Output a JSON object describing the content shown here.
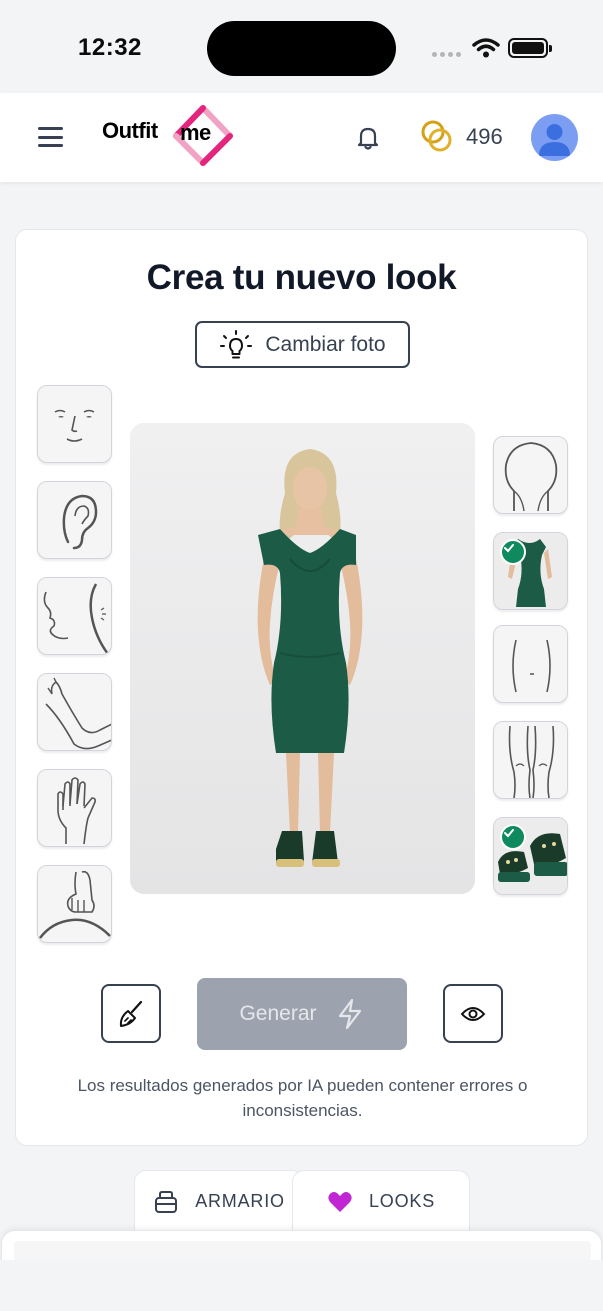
{
  "status_bar": {
    "time": "12:32"
  },
  "header": {
    "logo_part1": "Outfit",
    "logo_part2": "me",
    "coin_balance": "496",
    "icons": [
      "menu-icon",
      "bell-icon",
      "coins-icon",
      "avatar-icon"
    ]
  },
  "card": {
    "title": "Crea tu nuevo look",
    "change_photo_label": "Cambiar foto",
    "left_tiles": [
      {
        "name": "face",
        "icon": "face-icon"
      },
      {
        "name": "ear",
        "icon": "ear-icon"
      },
      {
        "name": "neck",
        "icon": "neck-icon"
      },
      {
        "name": "arm",
        "icon": "arm-icon"
      },
      {
        "name": "hand",
        "icon": "hand-icon"
      },
      {
        "name": "wrist",
        "icon": "wrist-icon"
      }
    ],
    "right_tiles": [
      {
        "name": "head",
        "icon": "head-icon",
        "selected": false
      },
      {
        "name": "dress",
        "icon": "dress-thumbnail",
        "selected": true
      },
      {
        "name": "torso",
        "icon": "torso-icon",
        "selected": false
      },
      {
        "name": "legs",
        "icon": "legs-icon",
        "selected": false
      },
      {
        "name": "shoes",
        "icon": "shoes-thumbnail",
        "selected": true
      }
    ],
    "generate_label": "Generar",
    "disclaimer": "Los resultados generados por IA pueden contener errores o inconsistencias."
  },
  "tabs": [
    {
      "label": "ARMARIO",
      "icon": "wardrobe-icon",
      "active": false
    },
    {
      "label": "LOOKS",
      "icon": "heart-icon",
      "active": true
    }
  ],
  "colors": {
    "accent_pink": "#e4257d",
    "check_green": "#0f8a5f",
    "dress_green": "#1c5b45",
    "heart_purple": "#c026d3",
    "coin_gold": "#d4a017"
  }
}
